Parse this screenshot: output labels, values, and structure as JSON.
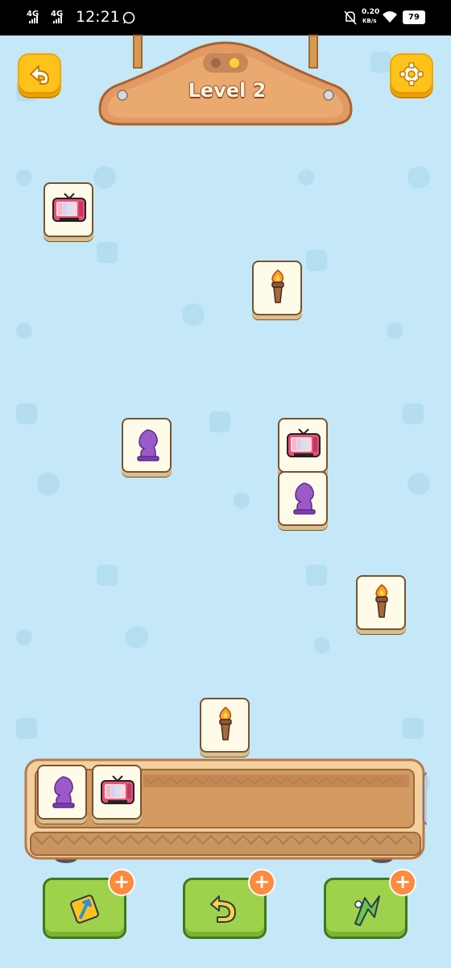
{
  "status_bar": {
    "network_1": "4G",
    "network_2": "4G",
    "time": "12:21",
    "data_speed_value": "0.20",
    "data_speed_unit": "KB/s",
    "battery": "79"
  },
  "header": {
    "level_label": "Level 2"
  },
  "board": {
    "tiles": [
      {
        "item": "tv"
      },
      {
        "item": "torch"
      },
      {
        "item": "chess-knight"
      },
      {
        "item": "tv"
      },
      {
        "item": "chess-knight"
      },
      {
        "item": "torch"
      },
      {
        "item": "torch"
      }
    ]
  },
  "tray": {
    "slots": [
      {
        "item": "chess-knight"
      },
      {
        "item": "tv"
      }
    ]
  },
  "powerups": [
    {
      "name": "shuffle",
      "badge": "+"
    },
    {
      "name": "undo",
      "badge": "+"
    },
    {
      "name": "hint",
      "badge": "+"
    }
  ],
  "colors": {
    "background": "#c4e8f7",
    "wood": "#e19a63",
    "button_yellow": "#ffc21a",
    "button_green": "#9ed24a",
    "tile_face": "#fffbe9"
  }
}
